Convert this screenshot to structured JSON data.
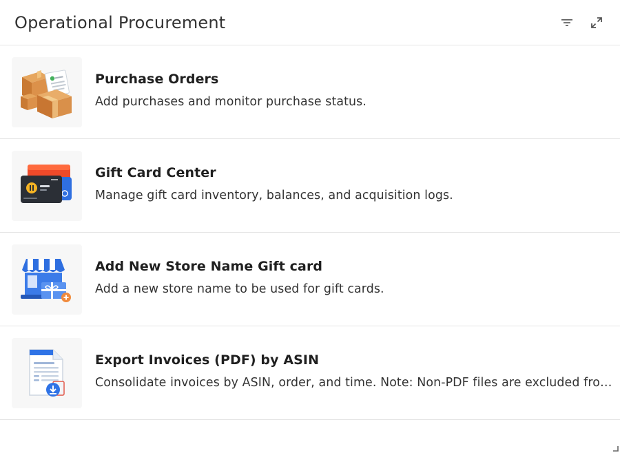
{
  "panel": {
    "title": "Operational Procurement",
    "filter_icon": "filter-icon",
    "expand_icon": "expand-icon"
  },
  "items": [
    {
      "title": "Purchase Orders",
      "description": "Add purchases and monitor purchase status.",
      "icon": "boxes-with-invoice-icon"
    },
    {
      "title": "Gift Card Center",
      "description": "Manage gift card inventory, balances, and acquisition logs.",
      "icon": "gift-card-icon"
    },
    {
      "title": "Add New Store Name Gift card",
      "description": "Add a new store name to be used for gift cards.",
      "icon": "store-gift-card-icon"
    },
    {
      "title": "Export Invoices (PDF) by ASIN",
      "description": "Consolidate invoices by ASIN, order, and time. Note: Non-PDF files are excluded from the export.",
      "icon": "invoice-download-icon"
    }
  ],
  "colors": {
    "box_brown": "#d9904a",
    "card_red": "#f04a2a",
    "card_dark": "#2b2f36",
    "card_gold": "#f5b324",
    "store_blue": "#2f6fe0",
    "doc_blue": "#2f73e6",
    "accent_orange": "#f08a3c"
  }
}
